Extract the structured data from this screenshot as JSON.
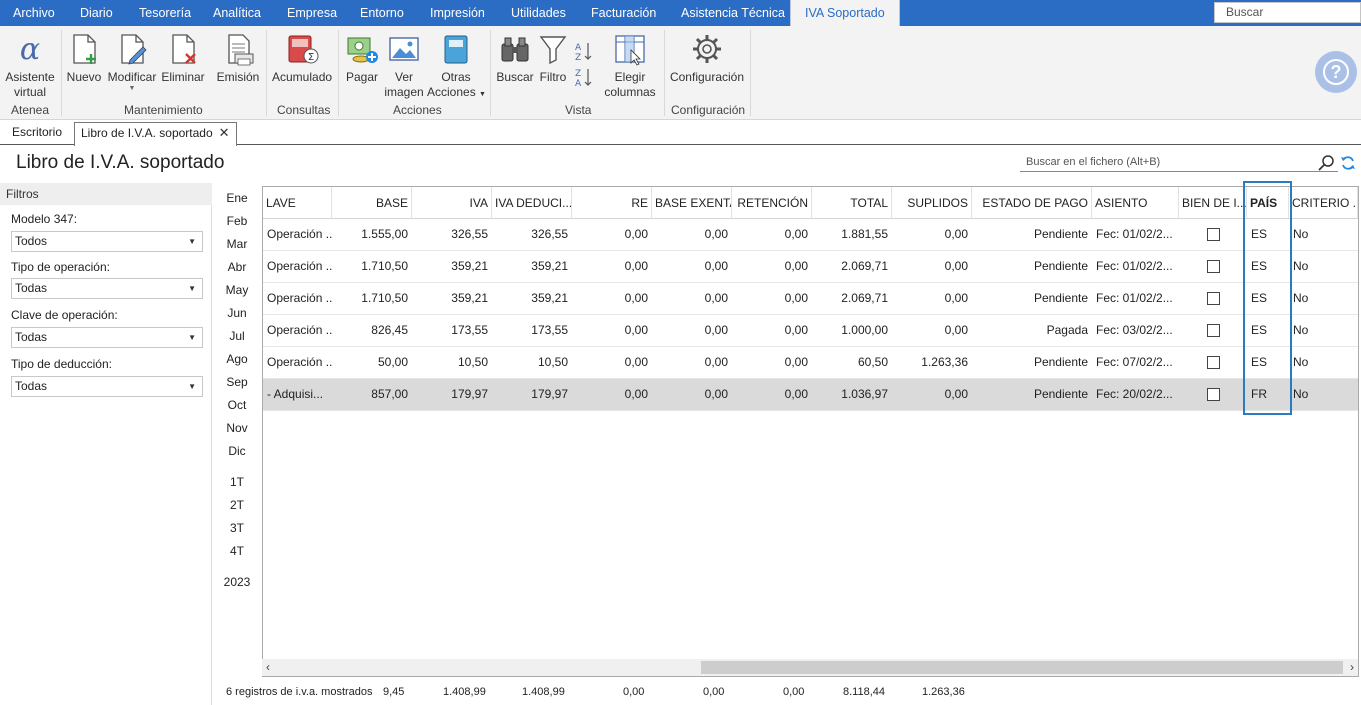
{
  "menu": {
    "items": [
      "Archivo",
      "Diario",
      "Tesorería",
      "Analítica",
      "Empresa",
      "Entorno",
      "Impresión",
      "Utilidades",
      "Facturación",
      "Asistencia Técnica"
    ],
    "active": "IVA Soportado",
    "search_placeholder": "Buscar"
  },
  "ribbon": {
    "atenea": "Atenea",
    "asistente_l1": "Asistente",
    "asistente_l2": "virtual",
    "nuevo": "Nuevo",
    "modificar": "Modificar",
    "eliminar": "Eliminar",
    "emision": "Emisión",
    "mantenimiento": "Mantenimiento",
    "acumulado": "Acumulado",
    "consultas": "Consultas",
    "pagar": "Pagar",
    "ver_l1": "Ver",
    "ver_l2": "imagen",
    "otras_l1": "Otras",
    "otras_l2": "Acciones",
    "acciones": "Acciones",
    "buscar": "Buscar",
    "filtro": "Filtro",
    "elegir_l1": "Elegir",
    "elegir_l2": "columnas",
    "vista": "Vista",
    "configuracion": "Configuración",
    "configuracion_group": "Configuración"
  },
  "tabs": {
    "escritorio": "Escritorio",
    "libro": "Libro de I.V.A. soportado"
  },
  "page": {
    "title": "Libro de I.V.A. soportado",
    "search_placeholder": "Buscar en el fichero (Alt+B)"
  },
  "filters": {
    "title": "Filtros",
    "modelo_label": "Modelo 347:",
    "modelo_value": "Todos",
    "tipo_op_label": "Tipo de operación:",
    "tipo_op_value": "Todas",
    "clave_label": "Clave de operación:",
    "clave_value": "Todas",
    "deduccion_label": "Tipo de deducción:",
    "deduccion_value": "Todas"
  },
  "months": [
    "Ene",
    "Feb",
    "Mar",
    "Abr",
    "May",
    "Jun",
    "Jul",
    "Ago",
    "Sep",
    "Oct",
    "Nov",
    "Dic"
  ],
  "quarters": [
    "1T",
    "2T",
    "3T",
    "4T"
  ],
  "year": "2023",
  "grid": {
    "headers": {
      "clave": "LAVE",
      "base": "BASE",
      "iva": "IVA",
      "iva_deducible": "IVA DEDUCI...",
      "re": "RE",
      "base_exenta": "BASE EXENTA",
      "retencion": "RETENCIÓN",
      "total": "TOTAL",
      "suplidos": "SUPLIDOS",
      "estado_pago": "ESTADO DE PAGO",
      "asiento": "ASIENTO",
      "bien_inversion": "BIEN DE I...",
      "pais": "PAÍS",
      "criterio": "CRITERIO ..."
    },
    "rows": [
      {
        "clave": "Operación ...",
        "base": "1.555,00",
        "iva": "326,55",
        "iva_deducible": "326,55",
        "re": "0,00",
        "base_exenta": "0,00",
        "retencion": "0,00",
        "total": "1.881,55",
        "suplidos": "0,00",
        "estado_pago": "Pendiente",
        "asiento": "Fec: 01/02/2...",
        "pais": "ES",
        "criterio": "No"
      },
      {
        "clave": "Operación ...",
        "base": "1.710,50",
        "iva": "359,21",
        "iva_deducible": "359,21",
        "re": "0,00",
        "base_exenta": "0,00",
        "retencion": "0,00",
        "total": "2.069,71",
        "suplidos": "0,00",
        "estado_pago": "Pendiente",
        "asiento": "Fec: 01/02/2...",
        "pais": "ES",
        "criterio": "No"
      },
      {
        "clave": "Operación ...",
        "base": "1.710,50",
        "iva": "359,21",
        "iva_deducible": "359,21",
        "re": "0,00",
        "base_exenta": "0,00",
        "retencion": "0,00",
        "total": "2.069,71",
        "suplidos": "0,00",
        "estado_pago": "Pendiente",
        "asiento": "Fec: 01/02/2...",
        "pais": "ES",
        "criterio": "No"
      },
      {
        "clave": "Operación ...",
        "base": "826,45",
        "iva": "173,55",
        "iva_deducible": "173,55",
        "re": "0,00",
        "base_exenta": "0,00",
        "retencion": "0,00",
        "total": "1.000,00",
        "suplidos": "0,00",
        "estado_pago": "Pagada",
        "asiento": "Fec: 03/02/2...",
        "pais": "ES",
        "criterio": "No"
      },
      {
        "clave": "Operación ...",
        "base": "50,00",
        "iva": "10,50",
        "iva_deducible": "10,50",
        "re": "0,00",
        "base_exenta": "0,00",
        "retencion": "0,00",
        "total": "60,50",
        "suplidos": "1.263,36",
        "estado_pago": "Pendiente",
        "asiento": "Fec: 07/02/2...",
        "pais": "ES",
        "criterio": "No"
      },
      {
        "clave": "- Adquisi...",
        "base": "857,00",
        "iva": "179,97",
        "iva_deducible": "179,97",
        "re": "0,00",
        "base_exenta": "0,00",
        "retencion": "0,00",
        "total": "1.036,97",
        "suplidos": "0,00",
        "estado_pago": "Pendiente",
        "asiento": "Fec: 20/02/2...",
        "pais": "FR",
        "criterio": "No"
      }
    ]
  },
  "footer": {
    "count_text": "6 registros de i.v.a. mostrados",
    "base": "9,45",
    "iva": "1.408,99",
    "iva_deducible": "1.408,99",
    "re": "0,00",
    "base_exenta": "0,00",
    "retencion": "0,00",
    "total": "8.118,44",
    "suplidos": "1.263,36"
  },
  "colors": {
    "menu_bar": "#2b6cc4",
    "highlight_border": "#2a7bc0",
    "selected_row": "#dadada"
  }
}
